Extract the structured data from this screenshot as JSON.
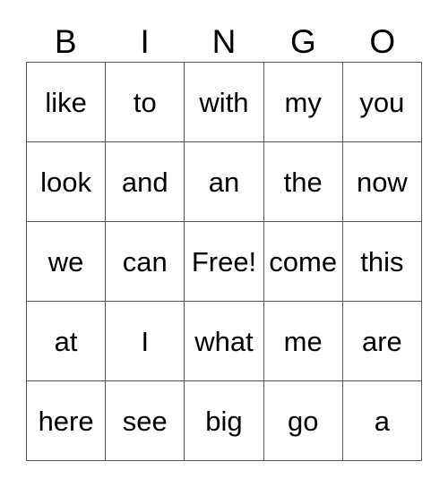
{
  "card": {
    "header_letters": [
      "B",
      "I",
      "N",
      "G",
      "O"
    ],
    "colors": {
      "background": "#ffffff",
      "text": "#000000",
      "grid_line": "#555555"
    },
    "grid": [
      [
        "like",
        "to",
        "with",
        "my",
        "you"
      ],
      [
        "look",
        "and",
        "an",
        "the",
        "now"
      ],
      [
        "we",
        "can",
        "Free!",
        "come",
        "this"
      ],
      [
        "at",
        "I",
        "what",
        "me",
        "are"
      ],
      [
        "here",
        "see",
        "big",
        "go",
        "a"
      ]
    ]
  }
}
